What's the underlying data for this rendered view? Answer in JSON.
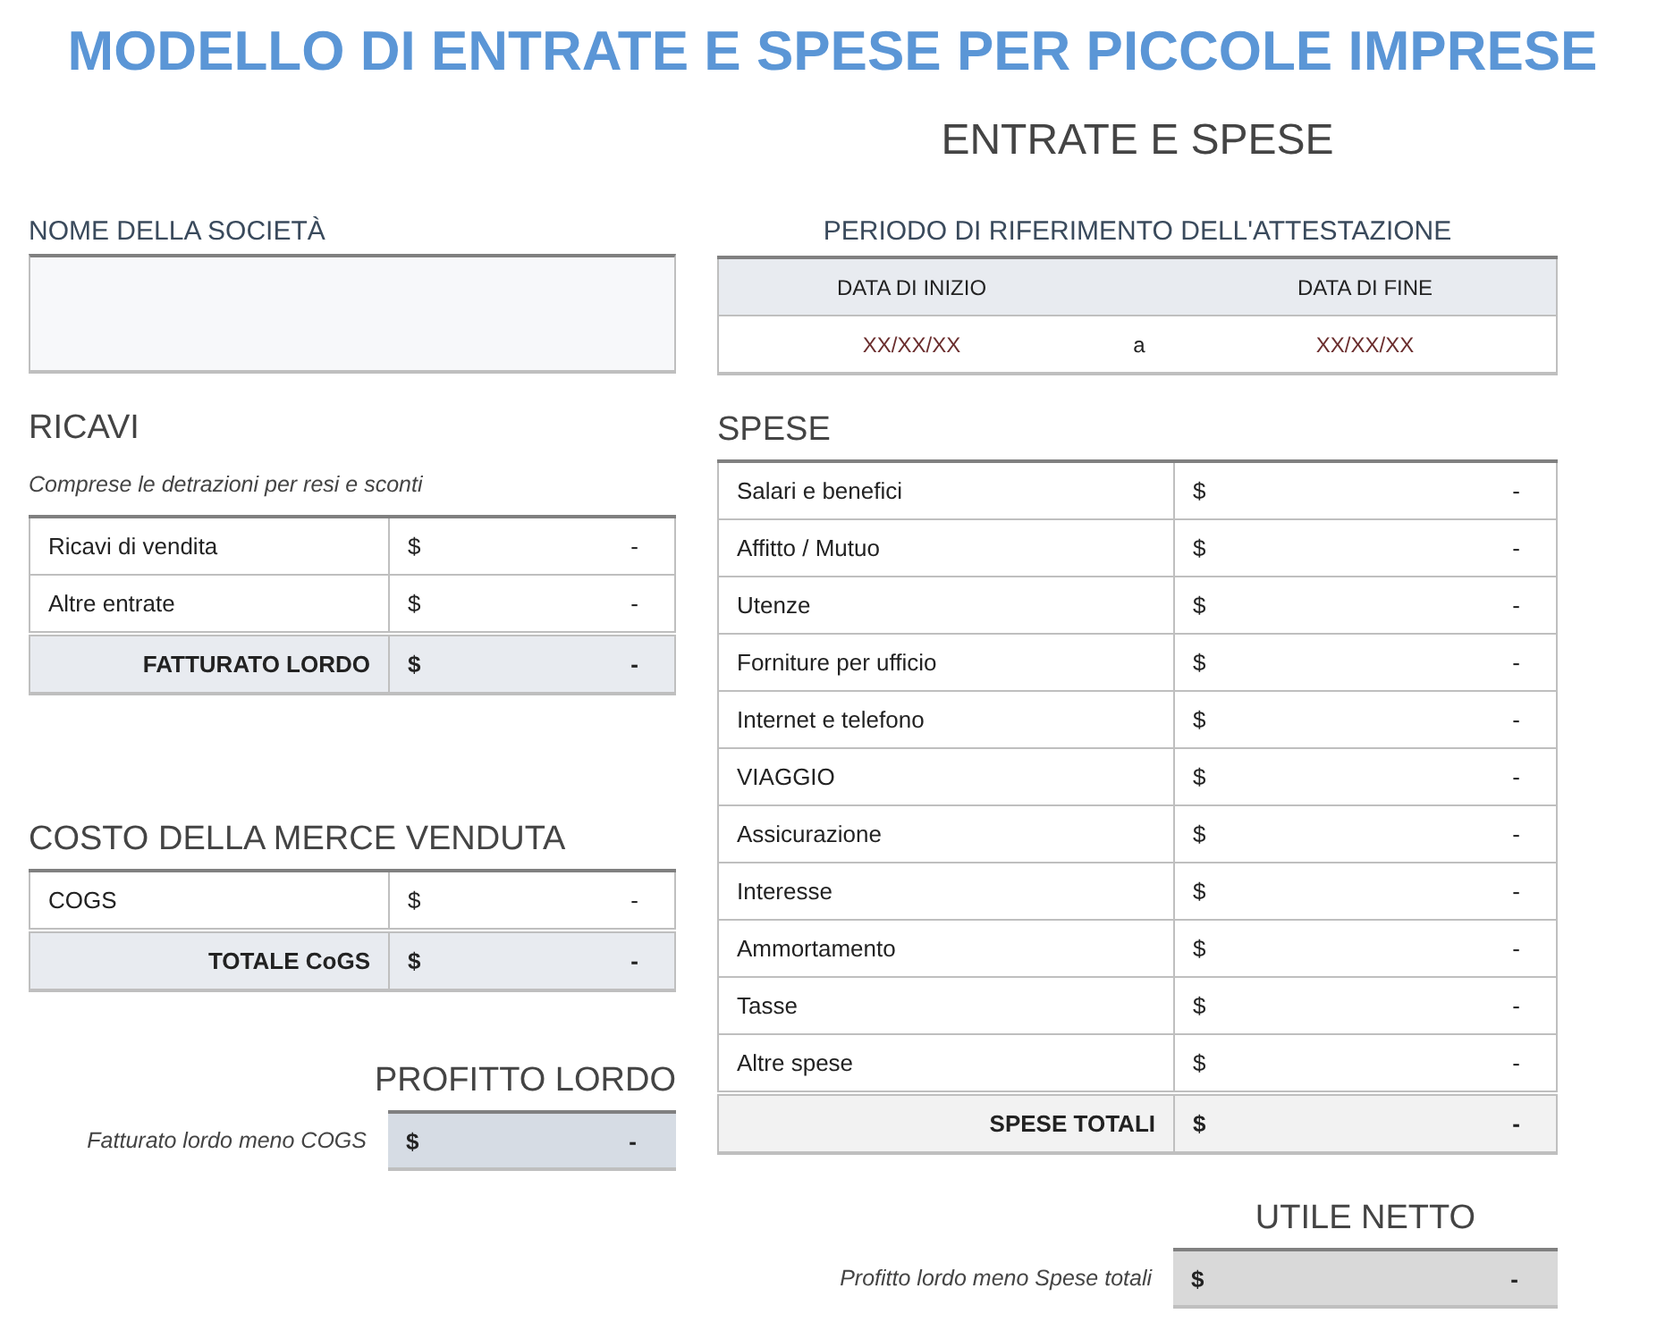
{
  "title": "MODELLO DI ENTRATE E SPESE PER PICCOLE IMPRESE",
  "subtitle": "ENTRATE E SPESE",
  "company": {
    "label": "NOME DELLA SOCIETÀ"
  },
  "period": {
    "label": "PERIODO DI RIFERIMENTO DELL'ATTESTAZIONE",
    "start_label": "DATA DI INIZIO",
    "end_label": "DATA DI FINE",
    "start": "XX/XX/XX",
    "separator": "a",
    "end": "XX/XX/XX"
  },
  "revenue": {
    "heading": "RICAVI",
    "note": "Comprese le detrazioni per resi e sconti",
    "rows": [
      {
        "label": "Ricavi di vendita",
        "currency": "$",
        "amount": "-"
      },
      {
        "label": "Altre entrate",
        "currency": "$",
        "amount": "-"
      }
    ],
    "total": {
      "label": "FATTURATO LORDO",
      "currency": "$",
      "amount": "-"
    }
  },
  "cogs": {
    "heading": "COSTO DELLA MERCE VENDUTA",
    "rows": [
      {
        "label": "COGS",
        "currency": "$",
        "amount": "-"
      }
    ],
    "total": {
      "label": "TOTALE CoGS",
      "currency": "$",
      "amount": "-"
    }
  },
  "gross_profit": {
    "heading": "PROFITTO LORDO",
    "note": "Fatturato lordo meno COGS",
    "currency": "$",
    "amount": "-"
  },
  "expenses": {
    "heading": "SPESE",
    "rows": [
      {
        "label": "Salari e benefici",
        "currency": "$",
        "amount": "-"
      },
      {
        "label": "Affitto / Mutuo",
        "currency": "$",
        "amount": "-"
      },
      {
        "label": "Utenze",
        "currency": "$",
        "amount": "-"
      },
      {
        "label": "Forniture per ufficio",
        "currency": "$",
        "amount": "-"
      },
      {
        "label": "Internet e telefono",
        "currency": "$",
        "amount": "-"
      },
      {
        "label": "VIAGGIO",
        "currency": "$",
        "amount": "-"
      },
      {
        "label": "Assicurazione",
        "currency": "$",
        "amount": "-"
      },
      {
        "label": "Interesse",
        "currency": "$",
        "amount": "-"
      },
      {
        "label": "Ammortamento",
        "currency": "$",
        "amount": "-"
      },
      {
        "label": "Tasse",
        "currency": "$",
        "amount": "-"
      },
      {
        "label": "Altre spese",
        "currency": "$",
        "amount": "-"
      }
    ],
    "total": {
      "label": "SPESE TOTALI",
      "currency": "$",
      "amount": "-"
    }
  },
  "net_income": {
    "heading": "UTILE NETTO",
    "note": "Profitto lordo meno Spese totali",
    "currency": "$",
    "amount": "-"
  }
}
